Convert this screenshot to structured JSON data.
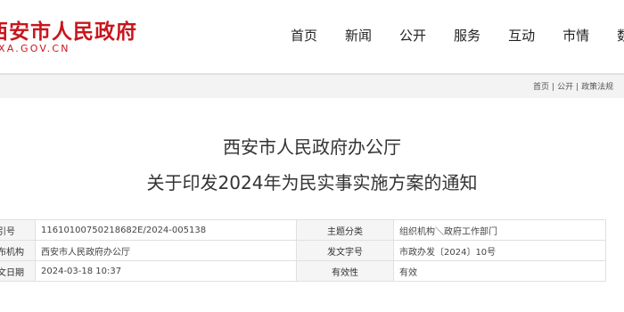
{
  "header": {
    "site_title": "西安市人民政府",
    "domain": "XA.GOV.CN"
  },
  "nav": {
    "items": [
      "首页",
      "新闻",
      "公开",
      "服务",
      "互动",
      "市情",
      "数据"
    ]
  },
  "breadcrumb": [
    "首页",
    "公开",
    "政策法规"
  ],
  "title": {
    "line1": "西安市人民政府办公厅",
    "line2": "关于印发2024年为民实事实施方案的通知"
  },
  "meta": {
    "rows": [
      {
        "label1": "索引号",
        "value1": "11610100750218682E/2024-005138",
        "label2": "主题分类",
        "value2": "组织机构＼政府工作部门"
      },
      {
        "label1": "发布机构",
        "value1": "西安市人民政府办公厅",
        "label2": "发文字号",
        "value2": "市政办发〔2024〕10号"
      },
      {
        "label1": "成文日期",
        "value1": "2024-03-18 10:37",
        "label2": "有效性",
        "value2": "有效"
      }
    ]
  },
  "colors": {
    "brand_red": "#c8161d",
    "crumb_bg": "#f3f3f3"
  }
}
